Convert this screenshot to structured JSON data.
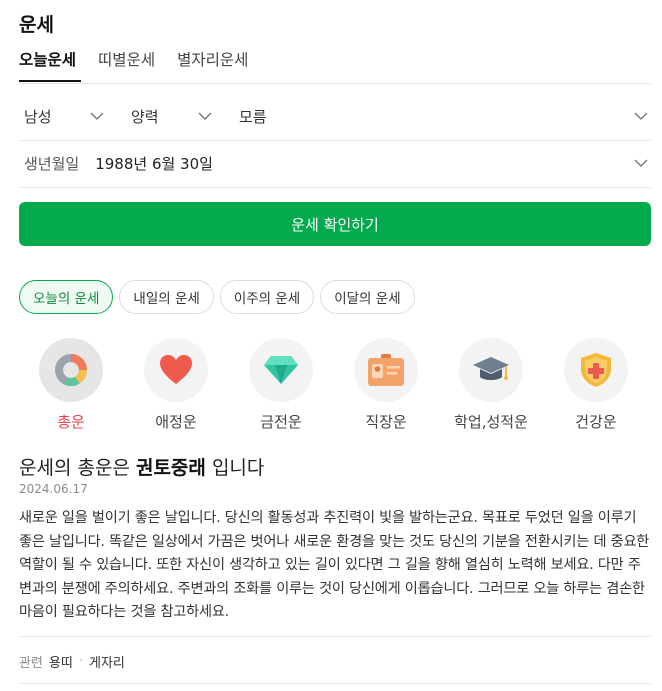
{
  "title": "운세",
  "tabs": [
    {
      "label": "오늘운세",
      "active": true
    },
    {
      "label": "띠별운세",
      "active": false
    },
    {
      "label": "별자리운세",
      "active": false
    }
  ],
  "selects": {
    "gender": "남성",
    "calendar": "양력",
    "time": "모름",
    "birth_label": "생년월일",
    "birth_value": "1988년 6월 30일"
  },
  "check_button": "운세 확인하기",
  "period_pills": [
    {
      "label": "오늘의 운세",
      "active": true
    },
    {
      "label": "내일의 운세",
      "active": false
    },
    {
      "label": "이주의 운세",
      "active": false
    },
    {
      "label": "이달의 운세",
      "active": false
    }
  ],
  "categories": [
    {
      "label": "총운",
      "icon": "donut-chart-icon",
      "active": true
    },
    {
      "label": "애정운",
      "icon": "heart-icon",
      "active": false
    },
    {
      "label": "금전운",
      "icon": "diamond-icon",
      "active": false
    },
    {
      "label": "직장운",
      "icon": "id-badge-icon",
      "active": false
    },
    {
      "label": "학업,성적운",
      "icon": "graduation-cap-icon",
      "active": false
    },
    {
      "label": "건강운",
      "icon": "health-shield-icon",
      "active": false
    }
  ],
  "result": {
    "title_prefix": "운세의 총운은",
    "title_keyword": "권토중래",
    "title_suffix": "입니다",
    "date": "2024.06.17",
    "body": "새로운 일을 벌이기 좋은 날입니다. 당신의 활동성과 추진력이 빛을 발하는군요. 목표로 두었던 일을 이루기 좋은 날입니다. 똑같은 일상에서 가끔은 벗어나 새로운 환경을 맞는 것도 당신의 기분을 전환시키는 데 중요한 역할이 될 수 있습니다. 또한 자신이 생각하고 있는 길이 있다면 그 길을 향해 열심히 노력해 보세요. 다만 주변과의 분쟁에 주의하세요. 주변과의 조화를 이루는 것이 당신에게 이롭습니다. 그러므로 오늘 하루는 겸손한 마음이 필요하다는 것을 참고하세요."
  },
  "related": {
    "label": "관련",
    "links": [
      "용띠",
      "게자리"
    ]
  },
  "colors": {
    "accent_green": "#03a94d",
    "active_red": "#e5404b"
  }
}
